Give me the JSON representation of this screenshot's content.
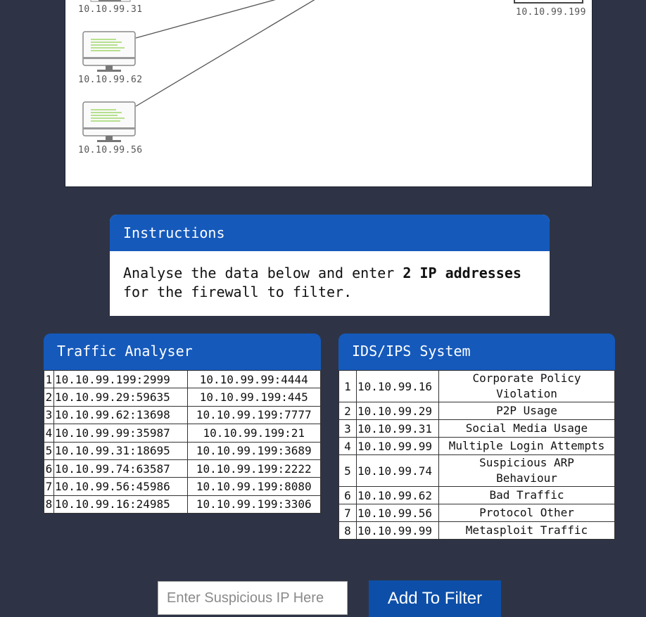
{
  "diagram": {
    "hosts": [
      {
        "ip": "10.10.99.31",
        "icon": "computer-icon"
      },
      {
        "ip": "10.10.99.62",
        "icon": "computer-icon"
      },
      {
        "ip": "10.10.99.56",
        "icon": "computer-icon"
      },
      {
        "ip": "10.10.99.199",
        "icon": "server-icon"
      }
    ]
  },
  "instructions": {
    "title": "Instructions",
    "text_before": "Analyse the data below and enter ",
    "text_bold": "2 IP addresses",
    "text_after": " for the firewall to filter."
  },
  "traffic_analyser": {
    "title": "Traffic Analyser",
    "rows": [
      {
        "n": "1",
        "src": "10.10.99.199:2999",
        "dst": "10.10.99.99:4444"
      },
      {
        "n": "2",
        "src": "10.10.99.29:59635",
        "dst": "10.10.99.199:445"
      },
      {
        "n": "3",
        "src": "10.10.99.62:13698",
        "dst": "10.10.99.199:7777"
      },
      {
        "n": "4",
        "src": "10.10.99.99:35987",
        "dst": "10.10.99.199:21"
      },
      {
        "n": "5",
        "src": "10.10.99.31:18695",
        "dst": "10.10.99.199:3689"
      },
      {
        "n": "6",
        "src": "10.10.99.74:63587",
        "dst": "10.10.99.199:2222"
      },
      {
        "n": "7",
        "src": "10.10.99.56:45986",
        "dst": "10.10.99.199:8080"
      },
      {
        "n": "8",
        "src": "10.10.99.16:24985",
        "dst": "10.10.99.199:3306"
      }
    ]
  },
  "ids_ips": {
    "title": "IDS/IPS System",
    "rows": [
      {
        "n": "1",
        "ip": "10.10.99.16",
        "desc": "Corporate Policy Violation"
      },
      {
        "n": "2",
        "ip": "10.10.99.29",
        "desc": "P2P Usage"
      },
      {
        "n": "3",
        "ip": "10.10.99.31",
        "desc": "Social Media Usage"
      },
      {
        "n": "4",
        "ip": "10.10.99.99",
        "desc": "Multiple Login Attempts"
      },
      {
        "n": "5",
        "ip": "10.10.99.74",
        "desc": "Suspicious ARP Behaviour"
      },
      {
        "n": "6",
        "ip": "10.10.99.62",
        "desc": "Bad Traffic"
      },
      {
        "n": "7",
        "ip": "10.10.99.56",
        "desc": "Protocol Other"
      },
      {
        "n": "8",
        "ip": "10.10.99.99",
        "desc": "Metasploit Traffic"
      }
    ]
  },
  "filter": {
    "placeholder": "Enter Suspicious IP Here",
    "value": "",
    "button_label": "Add To Filter"
  },
  "colors": {
    "background": "#2e3445",
    "panel_header": "#1559bb",
    "button": "#0d4fa8",
    "screen_text_lines": "#8fd14f"
  }
}
